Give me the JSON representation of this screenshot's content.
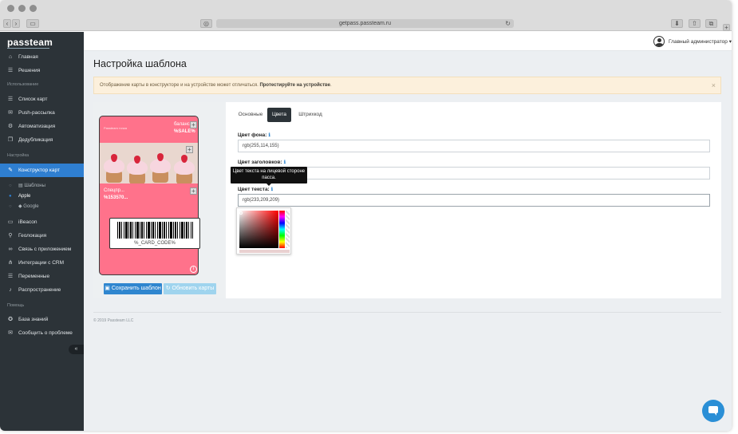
{
  "browser": {
    "url": "getpass.passteam.ru",
    "new_tab_glyph": "+"
  },
  "sidebar": {
    "logo": "passteam",
    "items_top": [
      {
        "label": "Главная",
        "icon": "home-icon"
      },
      {
        "label": "Решения",
        "icon": "list-icon"
      }
    ],
    "section_usage": "Использование",
    "items_usage": [
      {
        "label": "Список карт",
        "icon": "list-icon"
      },
      {
        "label": "Push-рассылка",
        "icon": "bullhorn-icon"
      },
      {
        "label": "Автоматизация",
        "icon": "cog-icon"
      },
      {
        "label": "Дедубликация",
        "icon": "copy-icon"
      }
    ],
    "section_settings": "Настройка",
    "active_item": {
      "label": "Конструктор карт",
      "icon": "wrench-icon"
    },
    "sub_items": [
      {
        "label": "Шаблоны",
        "icon": "template-icon"
      },
      {
        "label": "Apple",
        "icon": "apple-icon"
      },
      {
        "label": "Google",
        "icon": "google-icon"
      }
    ],
    "items_settings": [
      {
        "label": "iBeacon",
        "icon": "beacon-icon"
      },
      {
        "label": "Геолокация",
        "icon": "pin-icon"
      },
      {
        "label": "Связь с приложением",
        "icon": "link-icon"
      },
      {
        "label": "Интеграции с CRM",
        "icon": "sitemap-icon"
      },
      {
        "label": "Переменные",
        "icon": "list-icon"
      },
      {
        "label": "Распространение",
        "icon": "bell-icon"
      }
    ],
    "section_help": "Помощь",
    "items_help": [
      {
        "label": "База знаний",
        "icon": "lifebuoy-icon"
      },
      {
        "label": "Сообщить о проблеме",
        "icon": "comment-icon"
      }
    ]
  },
  "header": {
    "user_label": "Главный администратор"
  },
  "page": {
    "title": "Настройка шаблона",
    "alert_text": "Отображение карты в конструкторе и на устройстве может отличаться.",
    "alert_link": "Протестируйте на устройстве",
    "alert_end": "."
  },
  "pass": {
    "logo_text": "Passteam точка",
    "header_label": "баланс",
    "header_value": "%SALE%",
    "secondary_label": "Спецпр...",
    "secondary_value": "%153570...",
    "barcode_text": "%_CARD_CODE%",
    "background_color": "#ff728b"
  },
  "buttons": {
    "save": "Сохранить шаблон",
    "update": "Обновить карты"
  },
  "tabs": [
    {
      "label": "Основные"
    },
    {
      "label": "Цвета"
    },
    {
      "label": "Штрихкод"
    }
  ],
  "fields": {
    "bg_label": "Цвет фона:",
    "bg_value": "rgb(255,114,155)",
    "header_label": "Цвет заголовков:",
    "header_value": "",
    "text_label": "Цвет текста:",
    "text_value": "rgb(233,209,209)"
  },
  "tooltip": {
    "text": "Цвет текста на лицевой стороне пасса."
  },
  "footer": {
    "copyright": "© 2019 Passteam LLC"
  },
  "colors": {
    "sidebar_bg": "#2c3338",
    "accent": "#2f7fd1",
    "alert_bg": "#fcf0dc"
  }
}
